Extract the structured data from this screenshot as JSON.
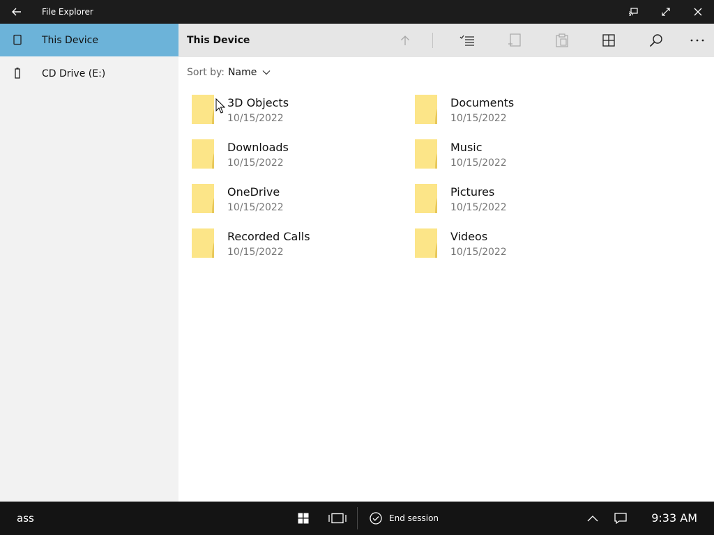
{
  "window": {
    "title": "File Explorer"
  },
  "sidebar": {
    "items": [
      {
        "label": "This Device",
        "icon": "tablet-icon",
        "selected": true
      },
      {
        "label": "CD Drive (E:)",
        "icon": "drive-icon",
        "selected": false
      }
    ]
  },
  "toolbar": {
    "breadcrumb": "This Device",
    "buttons": [
      "up-arrow-icon",
      "select-list-icon",
      "copy-icon",
      "paste-icon",
      "view-grid-icon",
      "search-icon",
      "more-icon"
    ]
  },
  "sort": {
    "label": "Sort by:",
    "value": "Name"
  },
  "folders": [
    {
      "name": "3D Objects",
      "date": "10/15/2022"
    },
    {
      "name": "Documents",
      "date": "10/15/2022"
    },
    {
      "name": "Downloads",
      "date": "10/15/2022"
    },
    {
      "name": "Music",
      "date": "10/15/2022"
    },
    {
      "name": "OneDrive",
      "date": "10/15/2022"
    },
    {
      "name": "Pictures",
      "date": "10/15/2022"
    },
    {
      "name": "Recorded Calls",
      "date": "10/15/2022"
    },
    {
      "name": "Videos",
      "date": "10/15/2022"
    }
  ],
  "taskbar": {
    "user": "ass",
    "end_session": "End session",
    "time": "9:33 AM"
  },
  "colors": {
    "titlebar": "#1c1c1c",
    "sidebar": "#f2f2f2",
    "selected": "#6cb3d9",
    "toolbar": "#e6e6e6",
    "folder": "#fce588",
    "taskbar": "#141414"
  }
}
